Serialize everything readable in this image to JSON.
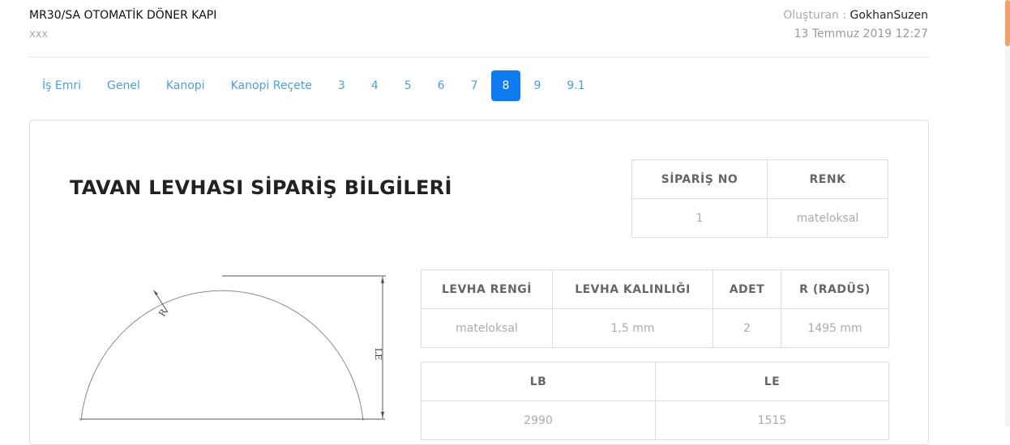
{
  "header": {
    "title": "MR30/SA OTOMATİK DÖNER KAPI",
    "subtitle": "xxx",
    "creator_label": "Oluşturan :",
    "creator_name": "GokhanSuzen",
    "date": "13 Temmuz 2019 12:27"
  },
  "tabs": [
    {
      "label": "İş Emri",
      "active": false
    },
    {
      "label": "Genel",
      "active": false
    },
    {
      "label": "Kanopi",
      "active": false
    },
    {
      "label": "Kanopi Reçete",
      "active": false
    },
    {
      "label": "3",
      "active": false
    },
    {
      "label": "4",
      "active": false
    },
    {
      "label": "5",
      "active": false
    },
    {
      "label": "6",
      "active": false
    },
    {
      "label": "7",
      "active": false
    },
    {
      "label": "8",
      "active": true
    },
    {
      "label": "9",
      "active": false
    },
    {
      "label": "9.1",
      "active": false
    }
  ],
  "section": {
    "heading": "TAVAN LEVHASI SİPARİŞ BİLGİLERİ"
  },
  "order_table": {
    "headers": [
      "SİPARİŞ NO",
      "RENK"
    ],
    "values": [
      "1",
      "mateloksal"
    ]
  },
  "sheet_table": {
    "headers": [
      "LEVHA RENGİ",
      "LEVHA KALINLIĞI",
      "ADET",
      "R (RADÜS)"
    ],
    "values": [
      "mateloksal",
      "1,5 mm",
      "2",
      "1495 mm"
    ]
  },
  "dims_table": {
    "headers": [
      "LB",
      "LE"
    ],
    "values": [
      "2990",
      "1515"
    ]
  },
  "drawing": {
    "radius_label": "R",
    "height_label": "LE"
  },
  "colors": {
    "accent": "#0d7bf2",
    "link": "#4a9ee0",
    "scroll_thumb": "#f0a06a"
  }
}
